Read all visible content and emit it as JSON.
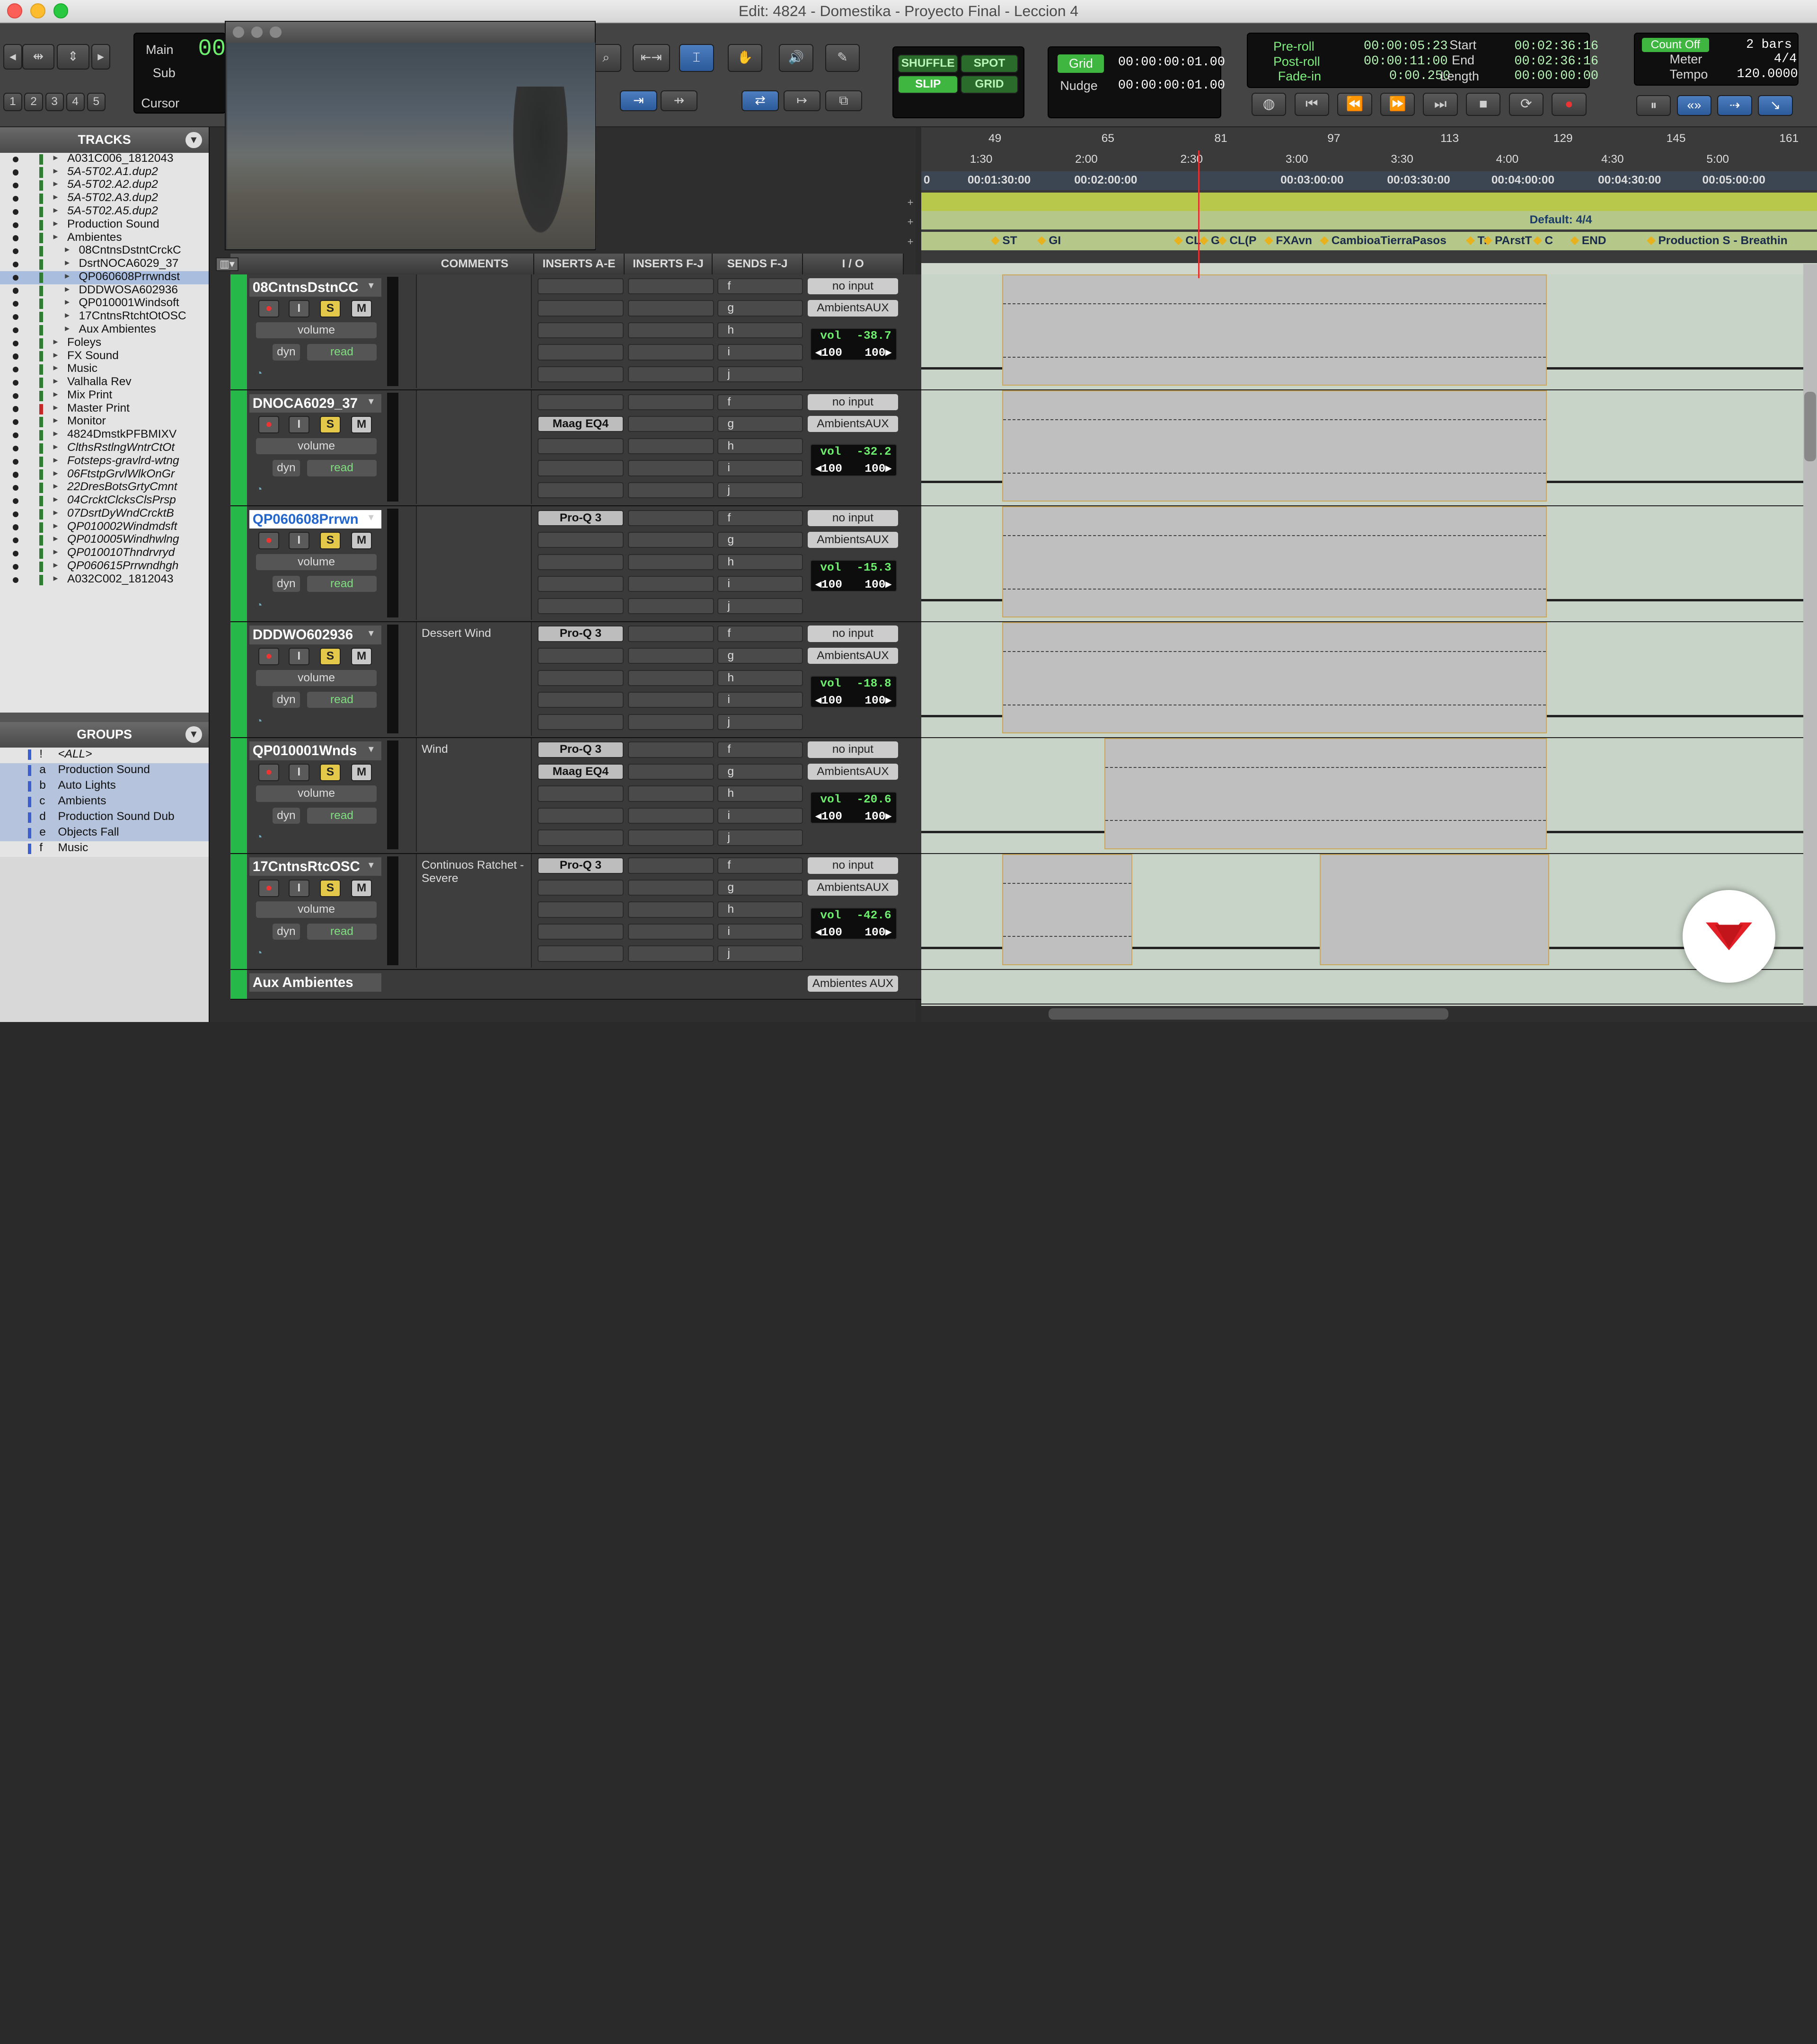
{
  "window": {
    "title": "Edit: 4824 - Domestika - Proyecto Final - Leccion 4"
  },
  "counter": {
    "main_label": "Main",
    "main_value": "00",
    "sub_label": "Sub",
    "cursor_label": "Cursor"
  },
  "toolbar_numbers": [
    "1",
    "2",
    "3",
    "4",
    "5"
  ],
  "edit_modes": {
    "shuffle": "SHUFFLE",
    "spot": "SPOT",
    "slip": "SLIP",
    "grid": "GRID"
  },
  "grid_panel": {
    "grid_label": "Grid",
    "grid_value": "00:00:00:01.00",
    "nudge_label": "Nudge",
    "nudge_value": "00:00:00:01.00"
  },
  "selection_panel": {
    "preroll_label": "Pre-roll",
    "preroll_value": "00:00:05:23",
    "postroll_label": "Post-roll",
    "postroll_value": "00:00:11:00",
    "fadein_label": "Fade-in",
    "fadein_value": "0:00.250",
    "start_label": "Start",
    "start_value": "00:02:36:16",
    "end_label": "End",
    "end_value": "00:02:36:16",
    "length_label": "Length",
    "length_value": "00:00:00:00"
  },
  "meter_panel": {
    "countoff_label": "Count Off",
    "countoff_value": "2 bars",
    "meter_label": "Meter",
    "meter_value": "4/4",
    "tempo_label": "Tempo",
    "tempo_value": "120.0000"
  },
  "tracks_panel": {
    "title": "TRACKS",
    "items": [
      {
        "name": "A031C006_1812043",
        "italic": false,
        "indent": 0,
        "color": "#2e7d32"
      },
      {
        "name": "5A-5T02.A1.dup2",
        "italic": true,
        "indent": 0,
        "color": "#2e7d32"
      },
      {
        "name": "5A-5T02.A2.dup2",
        "italic": true,
        "indent": 0,
        "color": "#2e7d32"
      },
      {
        "name": "5A-5T02.A3.dup2",
        "italic": true,
        "indent": 0,
        "color": "#2e7d32"
      },
      {
        "name": "5A-5T02.A5.dup2",
        "italic": true,
        "indent": 0,
        "color": "#2e7d32"
      },
      {
        "name": "Production Sound",
        "italic": false,
        "indent": 0,
        "color": "#2e7d32"
      },
      {
        "name": "Ambientes",
        "italic": false,
        "indent": 0,
        "color": "#2e7d32"
      },
      {
        "name": "08CntnsDstntCrckC",
        "italic": false,
        "indent": 1,
        "color": "#2e7d32"
      },
      {
        "name": "DsrtNOCA6029_37",
        "italic": false,
        "indent": 1,
        "color": "#2e7d32"
      },
      {
        "name": "QP060608Prrwndst",
        "italic": false,
        "indent": 1,
        "color": "#2e7d32"
      },
      {
        "name": "DDDWOSA602936",
        "italic": false,
        "indent": 1,
        "color": "#2e7d32"
      },
      {
        "name": "QP010001Windsoft",
        "italic": false,
        "indent": 1,
        "color": "#2e7d32"
      },
      {
        "name": "17CntnsRtchtOtOSC",
        "italic": false,
        "indent": 1,
        "color": "#2e7d32"
      },
      {
        "name": "Aux Ambientes",
        "italic": false,
        "indent": 1,
        "color": "#2e7d32"
      },
      {
        "name": "Foleys",
        "italic": false,
        "indent": 0,
        "color": "#2e7d32"
      },
      {
        "name": "FX Sound",
        "italic": false,
        "indent": 0,
        "color": "#2e7d32"
      },
      {
        "name": "Music",
        "italic": false,
        "indent": 0,
        "color": "#2e7d32"
      },
      {
        "name": "Valhalla Rev",
        "italic": false,
        "indent": 0,
        "color": "#2e7d32"
      },
      {
        "name": "Mix Print",
        "italic": false,
        "indent": 0,
        "color": "#2e7d32"
      },
      {
        "name": "Master Print",
        "italic": false,
        "indent": 0,
        "color": "#c62828"
      },
      {
        "name": "Monitor",
        "italic": false,
        "indent": 0,
        "color": "#2e7d32"
      },
      {
        "name": "4824DmstkPFBMIXV",
        "italic": false,
        "indent": 0,
        "color": "#2e7d32"
      },
      {
        "name": "ClthsRstlngWntrCtOt",
        "italic": true,
        "indent": 0,
        "color": "#2e7d32"
      },
      {
        "name": "Fotsteps-gravlrd-wtng",
        "italic": true,
        "indent": 0,
        "color": "#2e7d32"
      },
      {
        "name": "06FtstpGrvlWlkOnGr",
        "italic": true,
        "indent": 0,
        "color": "#2e7d32"
      },
      {
        "name": "22DresBotsGrtyCmnt",
        "italic": true,
        "indent": 0,
        "color": "#2e7d32"
      },
      {
        "name": "04CrcktClcksClsPrsp",
        "italic": true,
        "indent": 0,
        "color": "#2e7d32"
      },
      {
        "name": "07DsrtDyWndCrcktB",
        "italic": true,
        "indent": 0,
        "color": "#2e7d32"
      },
      {
        "name": "QP010002Windmdsft",
        "italic": true,
        "indent": 0,
        "color": "#2e7d32"
      },
      {
        "name": "QP010005Windhwlng",
        "italic": true,
        "indent": 0,
        "color": "#2e7d32"
      },
      {
        "name": "QP010010Thndrvryd",
        "italic": true,
        "indent": 0,
        "color": "#2e7d32"
      },
      {
        "name": "QP060615Prrwndhgh",
        "italic": true,
        "indent": 0,
        "color": "#2e7d32"
      },
      {
        "name": "A032C002_1812043",
        "italic": false,
        "indent": 0,
        "color": "#2e7d32"
      }
    ]
  },
  "groups_panel": {
    "title": "GROUPS",
    "items": [
      {
        "key": "!",
        "name": "<ALL>"
      },
      {
        "key": "a",
        "name": "Production Sound"
      },
      {
        "key": "b",
        "name": "Auto Lights"
      },
      {
        "key": "c",
        "name": "Ambients"
      },
      {
        "key": "d",
        "name": "Production Sound Dub"
      },
      {
        "key": "e",
        "name": "Objects Fall"
      },
      {
        "key": "f",
        "name": "Music"
      }
    ]
  },
  "mixer_columns": {
    "comments": "COMMENTS",
    "inserts_ae": "INSERTS A-E",
    "inserts_fj": "INSERTS F-J",
    "sends_fj": "SENDS F-J",
    "io": "I / O"
  },
  "send_letters": [
    "f",
    "g",
    "h",
    "i",
    "j"
  ],
  "strip_labels": {
    "volume": "volume",
    "dyn": "dyn",
    "read": "read",
    "rec": "●",
    "input": "I",
    "solo": "S",
    "mute": "M",
    "no_input": "no input",
    "vol": "vol",
    "pan_l": "◂100",
    "pan_r": "100▸"
  },
  "tracks": [
    {
      "name": "08CntnsDstnCC",
      "comment": "",
      "inserts": [],
      "output": "AmbientsAUX",
      "vol": "-38.7"
    },
    {
      "name": "DNOCA6029_37",
      "comment": "",
      "inserts": [
        "",
        "Maag EQ4"
      ],
      "output": "AmbientsAUX",
      "vol": "-32.2"
    },
    {
      "name": "QP060608Prrwn",
      "comment": "",
      "inserts": [
        "Pro-Q 3"
      ],
      "output": "AmbientsAUX",
      "vol": "-15.3"
    },
    {
      "name": "DDDWO602936",
      "comment": "Dessert Wind",
      "inserts": [
        "Pro-Q 3"
      ],
      "output": "AmbientsAUX",
      "vol": "-18.8"
    },
    {
      "name": "QP010001Wnds",
      "comment": "Wind",
      "inserts": [
        "Pro-Q 3",
        "Maag EQ4"
      ],
      "output": "AmbientsAUX",
      "vol": "-20.6"
    },
    {
      "name": "17CntnsRtcOSC",
      "comment": "Continuos Ratchet - Severe",
      "inserts": [
        "Pro-Q 3"
      ],
      "output": "AmbientsAUX",
      "vol": "-42.6"
    }
  ],
  "aux_track": {
    "name": "Aux Ambientes",
    "output": "Ambientes AUX"
  },
  "ruler": {
    "bars": [
      "49",
      "65",
      "81",
      "97",
      "113",
      "129",
      "145",
      "161"
    ],
    "minsecs": [
      "1:30",
      "2:00",
      "2:30",
      "3:00",
      "3:30",
      "4:00",
      "4:30",
      "5:00"
    ],
    "timecodes": [
      "0",
      "00:01:30:00",
      "00:02:00:00",
      "00:03:00:00",
      "00:03:30:00",
      "00:04:00:00",
      "00:04:30:00",
      "00:05:00:00"
    ],
    "meter_default": "Default: 4/4",
    "markers": [
      "ST",
      "GI",
      "CL",
      "G",
      "CL(P",
      "FXAvn",
      "CambioaTierraPasos",
      "Tr",
      "PArstT",
      "C",
      "END",
      "Production S - Breathin"
    ]
  },
  "colors": {
    "accent": "#27b84a",
    "clip_border": "#c9a85a",
    "lcd_text": "#b8f6b8",
    "selected_blue": "#2c5a9a"
  }
}
